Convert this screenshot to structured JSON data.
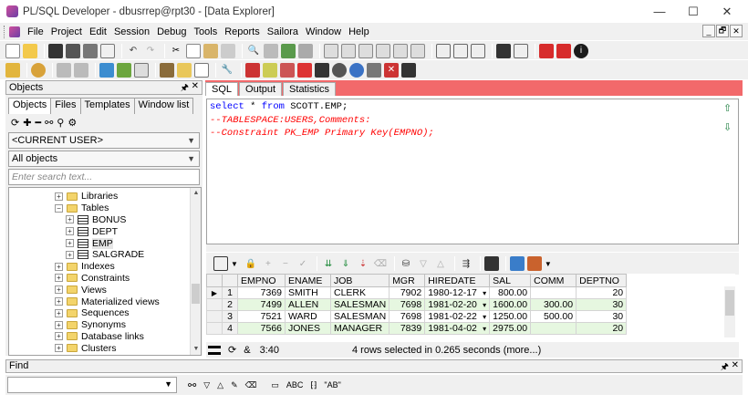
{
  "window": {
    "title": "PL/SQL Developer - dbusrrep@rpt30 - [Data Explorer]",
    "controls": [
      "—",
      "☐",
      "✕"
    ]
  },
  "menu": {
    "items": [
      "File",
      "Project",
      "Edit",
      "Session",
      "Debug",
      "Tools",
      "Reports",
      "Sailora",
      "Window",
      "Help"
    ],
    "mdi": [
      "_",
      "🗗",
      "✕"
    ]
  },
  "objects_panel": {
    "title": "Objects",
    "tabs": [
      "Objects",
      "Files",
      "Templates",
      "Window list"
    ],
    "user_select": "<CURRENT USER>",
    "filter_select": "All objects",
    "search_placeholder": "Enter search text...",
    "tree": [
      {
        "label": "Libraries",
        "type": "folder",
        "expander": "+"
      },
      {
        "label": "Tables",
        "type": "folder",
        "expander": "−"
      },
      {
        "label": "BONUS",
        "type": "table",
        "expander": "+"
      },
      {
        "label": "DEPT",
        "type": "table",
        "expander": "+"
      },
      {
        "label": "EMP",
        "type": "table",
        "expander": "+",
        "selected": true
      },
      {
        "label": "SALGRADE",
        "type": "table",
        "expander": "+"
      },
      {
        "label": "Indexes",
        "type": "folder",
        "expander": "+"
      },
      {
        "label": "Constraints",
        "type": "folder",
        "expander": "+"
      },
      {
        "label": "Views",
        "type": "folder",
        "expander": "+"
      },
      {
        "label": "Materialized views",
        "type": "folder",
        "expander": "+"
      },
      {
        "label": "Sequences",
        "type": "folder",
        "expander": "+"
      },
      {
        "label": "Synonyms",
        "type": "folder",
        "expander": "+"
      },
      {
        "label": "Database links",
        "type": "folder",
        "expander": "+"
      },
      {
        "label": "Clusters",
        "type": "folder",
        "expander": "+"
      }
    ]
  },
  "sql_window": {
    "tabs": [
      "SQL",
      "Output",
      "Statistics"
    ],
    "tab_bar_color": "#f2696b",
    "code": [
      {
        "kw1": "select",
        "rest": " * ",
        "kw2": "from",
        "tail": " SCOTT.EMP;"
      },
      {
        "comment": "--TABLESPACE:USERS,Comments:"
      },
      {
        "comment": "--Constraint PK_EMP Primary Key(EMPNO);"
      }
    ]
  },
  "grid": {
    "columns": [
      "EMPNO",
      "ENAME",
      "JOB",
      "MGR",
      "HIREDATE",
      "SAL",
      "COMM",
      "DEPTNO"
    ],
    "rows": [
      {
        "n": "1",
        "EMPNO": "7369",
        "ENAME": "SMITH",
        "JOB": "CLERK",
        "MGR": "7902",
        "HIREDATE": "1980-12-17",
        "SAL": "800.00",
        "COMM": "",
        "DEPTNO": "20"
      },
      {
        "n": "2",
        "EMPNO": "7499",
        "ENAME": "ALLEN",
        "JOB": "SALESMAN",
        "MGR": "7698",
        "HIREDATE": "1981-02-20",
        "SAL": "1600.00",
        "COMM": "300.00",
        "DEPTNO": "30"
      },
      {
        "n": "3",
        "EMPNO": "7521",
        "ENAME": "WARD",
        "JOB": "SALESMAN",
        "MGR": "7698",
        "HIREDATE": "1981-02-22",
        "SAL": "1250.00",
        "COMM": "500.00",
        "DEPTNO": "30"
      },
      {
        "n": "4",
        "EMPNO": "7566",
        "ENAME": "JONES",
        "JOB": "MANAGER",
        "MGR": "7839",
        "HIREDATE": "1981-04-02",
        "SAL": "2975.00",
        "COMM": "",
        "DEPTNO": "20"
      }
    ],
    "even_row_color": "#e6f7e0"
  },
  "status": {
    "position": "3:40",
    "message": "4 rows selected in 0.265 seconds (more...)"
  },
  "find_panel": {
    "title": "Find",
    "option_labels": [
      "ABC",
      "\"AB\""
    ]
  }
}
